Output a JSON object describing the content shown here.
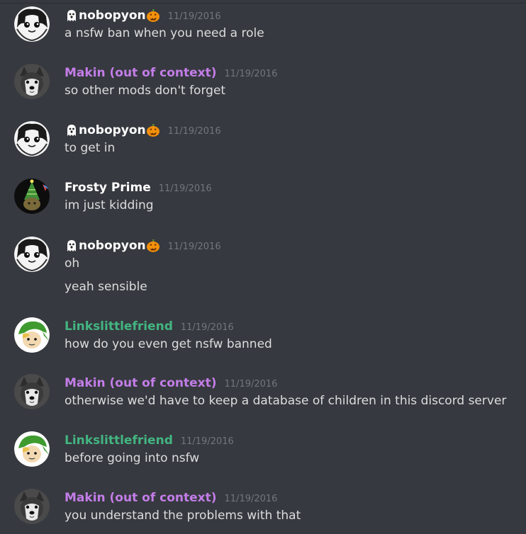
{
  "colors": {
    "background": "#36393f",
    "text": "#dcddde",
    "timestamp": "#72767d",
    "name_default": "#ffffff",
    "name_purple": "#c37de8",
    "name_green": "#43b581"
  },
  "messages": [
    {
      "author": "nobopyon",
      "prefix_icon": "ghost-emoji",
      "suffix_icon": "jack-o-lantern-emoji",
      "name_color": "#ffffff",
      "avatar": "manga-girl-avatar",
      "timestamp": "11/19/2016",
      "lines": [
        "a nsfw ban when you need a role"
      ]
    },
    {
      "author": "Makin (out of context)",
      "name_color": "#c37de8",
      "avatar": "husky-dog-avatar",
      "timestamp": "11/19/2016",
      "lines": [
        "so other mods don't forget"
      ]
    },
    {
      "author": "nobopyon",
      "prefix_icon": "ghost-emoji",
      "suffix_icon": "jack-o-lantern-emoji",
      "name_color": "#ffffff",
      "avatar": "manga-girl-avatar",
      "timestamp": "11/19/2016",
      "lines": [
        "to get in"
      ]
    },
    {
      "author": "Frosty Prime",
      "name_color": "#ffffff",
      "avatar": "party-hat-avatar",
      "timestamp": "11/19/2016",
      "lines": [
        "im just kidding"
      ]
    },
    {
      "author": "nobopyon",
      "prefix_icon": "ghost-emoji",
      "suffix_icon": "jack-o-lantern-emoji",
      "name_color": "#ffffff",
      "avatar": "manga-girl-avatar",
      "timestamp": "11/19/2016",
      "lines": [
        "oh",
        "yeah sensible"
      ]
    },
    {
      "author": "Linkslittlefriend",
      "name_color": "#43b581",
      "avatar": "green-cap-elf-avatar",
      "timestamp": "11/19/2016",
      "lines": [
        "how do you even get nsfw banned"
      ]
    },
    {
      "author": "Makin (out of context)",
      "name_color": "#c37de8",
      "avatar": "husky-dog-avatar",
      "timestamp": "11/19/2016",
      "lines": [
        "otherwise we'd have to keep a database of children in this discord server"
      ]
    },
    {
      "author": "Linkslittlefriend",
      "name_color": "#43b581",
      "avatar": "green-cap-elf-avatar",
      "timestamp": "11/19/2016",
      "lines": [
        "before going into nsfw"
      ]
    },
    {
      "author": "Makin (out of context)",
      "name_color": "#c37de8",
      "avatar": "husky-dog-avatar",
      "timestamp": "11/19/2016",
      "lines": [
        "you understand the problems with that"
      ]
    }
  ]
}
